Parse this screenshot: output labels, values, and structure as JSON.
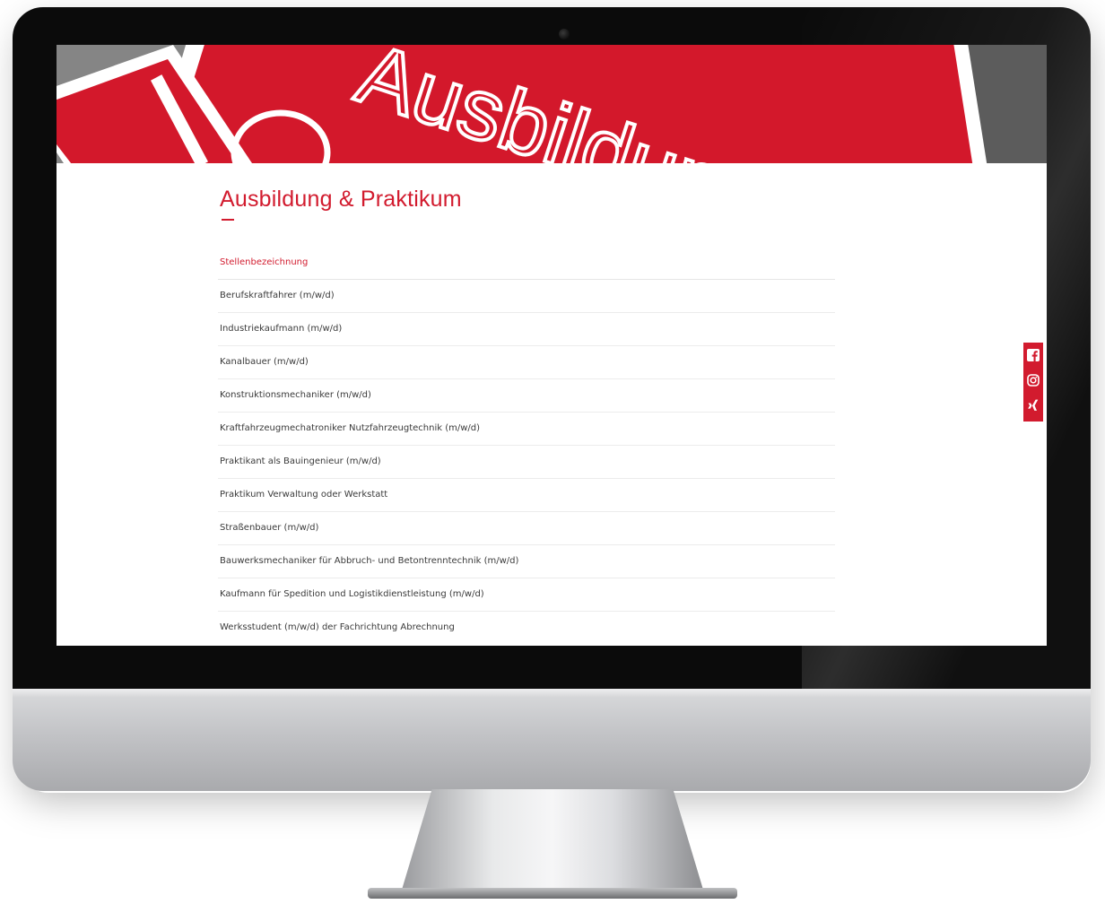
{
  "hero": {
    "banner_text": "Ausbildung",
    "colors": {
      "red": "#d21b2e",
      "grey": "#6e6e6e"
    }
  },
  "page": {
    "title": "Ausbildung & Praktikum"
  },
  "jobs": {
    "header": "Stellenbezeichnung",
    "rows": [
      "Berufskraftfahrer (m/w/d)",
      "Industriekaufmann (m/w/d)",
      "Kanalbauer (m/w/d)",
      "Konstruktionsmechaniker (m/w/d)",
      "Kraftfahrzeugmechatroniker Nutzfahrzeugtechnik (m/w/d)",
      "Praktikant als Bauingenieur (m/w/d)",
      "Praktikum Verwaltung oder Werkstatt",
      "Straßenbauer (m/w/d)",
      "Bauwerksmechaniker für Abbruch- und Betontrenntechnik (m/w/d)",
      "Kaufmann für Spedition und Logistikdienstleistung (m/w/d)",
      "Werksstudent (m/w/d) der Fachrichtung Abrechnung"
    ]
  },
  "social": {
    "icons": [
      "facebook-icon",
      "instagram-icon",
      "xing-icon"
    ],
    "accent": "#d21b2e"
  }
}
